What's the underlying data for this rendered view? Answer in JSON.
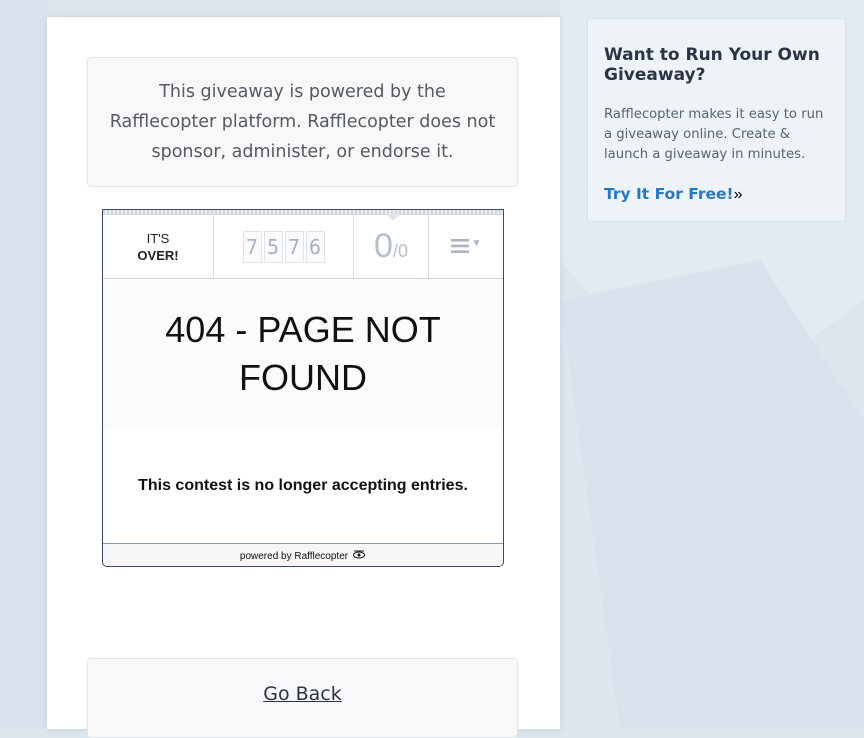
{
  "disclaimer": {
    "text": "This giveaway is powered by the Rafflecopter platform. Rafflecopter does not sponsor, administer, or endorse it."
  },
  "widget": {
    "status_line1": "IT'S",
    "status_line2": "OVER!",
    "counter_digits": [
      "7",
      "5",
      "7",
      "6"
    ],
    "entries_count": "0",
    "entries_total": "/0",
    "menu_icon": "hamburger-menu-icon",
    "heading": "404 - PAGE NOT FOUND",
    "message": "This contest is no longer accepting entries.",
    "footer_text": "powered by Rafflecopter",
    "footer_icon": "rafflecopter-logo-icon"
  },
  "go_back": {
    "label": "Go Back"
  },
  "sidebar": {
    "title": "Want to Run Your Own Giveaway?",
    "text": "Rafflecopter makes it easy to run a giveaway online. Create & launch a giveaway in minutes.",
    "cta_label": "Try It For Free!",
    "cta_arrow": "»"
  },
  "colors": {
    "background": "#dde6ef",
    "accent_link": "#2577c6",
    "widget_border": "#3a4a66"
  }
}
